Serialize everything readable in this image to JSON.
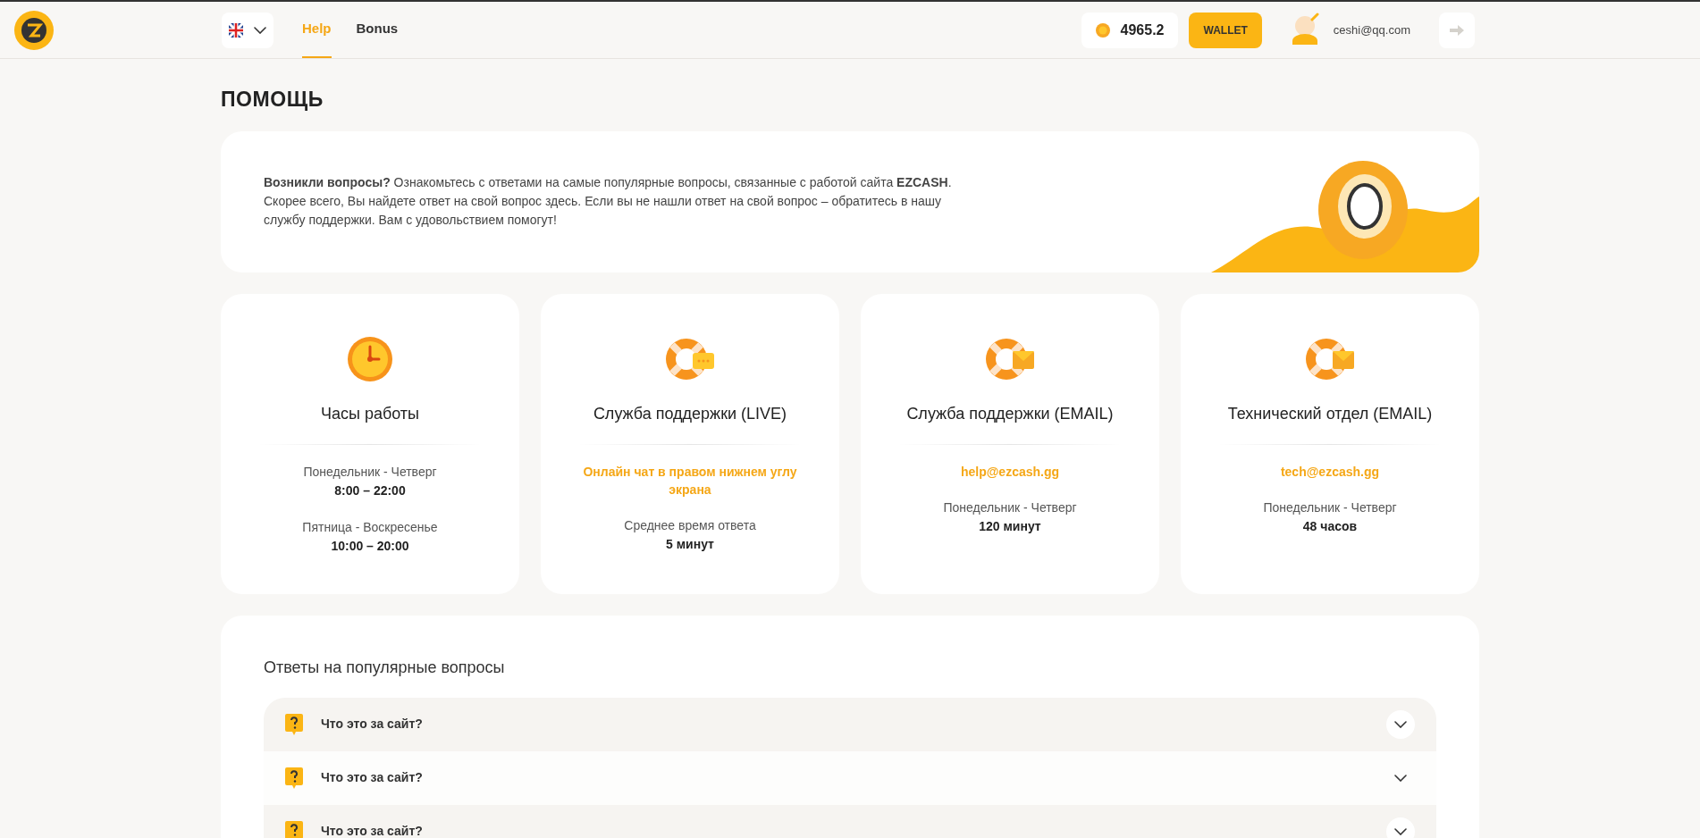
{
  "header": {
    "nav": [
      {
        "label": "Help",
        "selected": true
      },
      {
        "label": "Bonus",
        "selected": false
      }
    ],
    "balance": "4965.2",
    "wallet_button": "WALLET",
    "user_email": "ceshi@qq.com"
  },
  "page_title": "ПОМОЩЬ",
  "intro": {
    "text": "**Возникли вопросы?** Ознакомьтесь с ответами на самые популярные вопросы, связанные с работой сайта **EZCASH**. Скорее всего, Вы найдете ответ на свой вопрос здесь. Если вы не нашли ответ на свой вопрос – обратитесь в нашу службу поддержки. Вам с удовольствием помогут!"
  },
  "contact_cards": [
    {
      "kind": "clock",
      "title": "Часы работы",
      "lines": [
        {
          "kind": "plain",
          "text": "Понедельник - Четверг"
        },
        {
          "kind": "strong",
          "text": "8:00 – 22:00"
        },
        {
          "kind": "gap",
          "text": "Пятница - Воскресенье"
        },
        {
          "kind": "strong",
          "text": "10:00 – 20:00"
        }
      ]
    },
    {
      "kind": "chat",
      "title": "Служба поддержки (LIVE)",
      "lines": [
        {
          "kind": "accent",
          "text": "Онлайн чат в правом нижнем углу экрана"
        },
        {
          "kind": "gap",
          "text": "Среднее время ответа"
        },
        {
          "kind": "strong",
          "text": "5 минут"
        }
      ]
    },
    {
      "kind": "mail",
      "title": "Служба поддержки (EMAIL)",
      "lines": [
        {
          "kind": "accent",
          "text": "help@ezcash.gg"
        },
        {
          "kind": "gap",
          "text": "Понедельник - Четверг"
        },
        {
          "kind": "strong",
          "text": "120 минут"
        }
      ]
    },
    {
      "kind": "mail",
      "title": "Технический отдел (EMAIL)",
      "lines": [
        {
          "kind": "accent",
          "text": "tech@ezcash.gg"
        },
        {
          "kind": "gap",
          "text": "Понедельник - Четверг"
        },
        {
          "kind": "strong",
          "text": "48 часов"
        }
      ]
    }
  ],
  "faq": {
    "title": "Ответы на популярные вопросы",
    "items": [
      {
        "question": "Что это за сайт?",
        "expanded": false
      },
      {
        "question": "Что это за сайт?",
        "expanded": false
      },
      {
        "question": "Что это за сайт?",
        "expanded": false
      }
    ]
  }
}
